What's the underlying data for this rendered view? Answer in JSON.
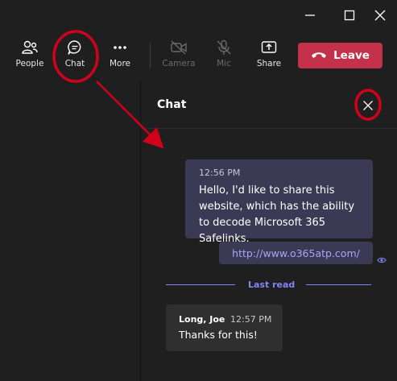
{
  "window_controls": {
    "minimize_icon": "minimize-icon",
    "maximize_icon": "maximize-icon",
    "close_icon": "close-icon"
  },
  "toolbar": {
    "people_label": "People",
    "chat_label": "Chat",
    "more_label": "More",
    "camera_label": "Camera",
    "mic_label": "Mic",
    "share_label": "Share",
    "leave_label": "Leave"
  },
  "chat": {
    "title": "Chat",
    "outgoing": {
      "timestamp": "12:56 PM",
      "text": "Hello, I'd like to share this website, which has the ability to decode Microsoft 365 Safelinks.",
      "link": "http://www.o365atp.com/"
    },
    "last_read_label": "Last read",
    "incoming": {
      "author": "Long, Joe",
      "timestamp": "12:57 PM",
      "text": "Thanks for this!"
    }
  },
  "colors": {
    "accent": "#7f85f5",
    "leave_button": "#c4314b",
    "annotation": "#d0021b"
  }
}
